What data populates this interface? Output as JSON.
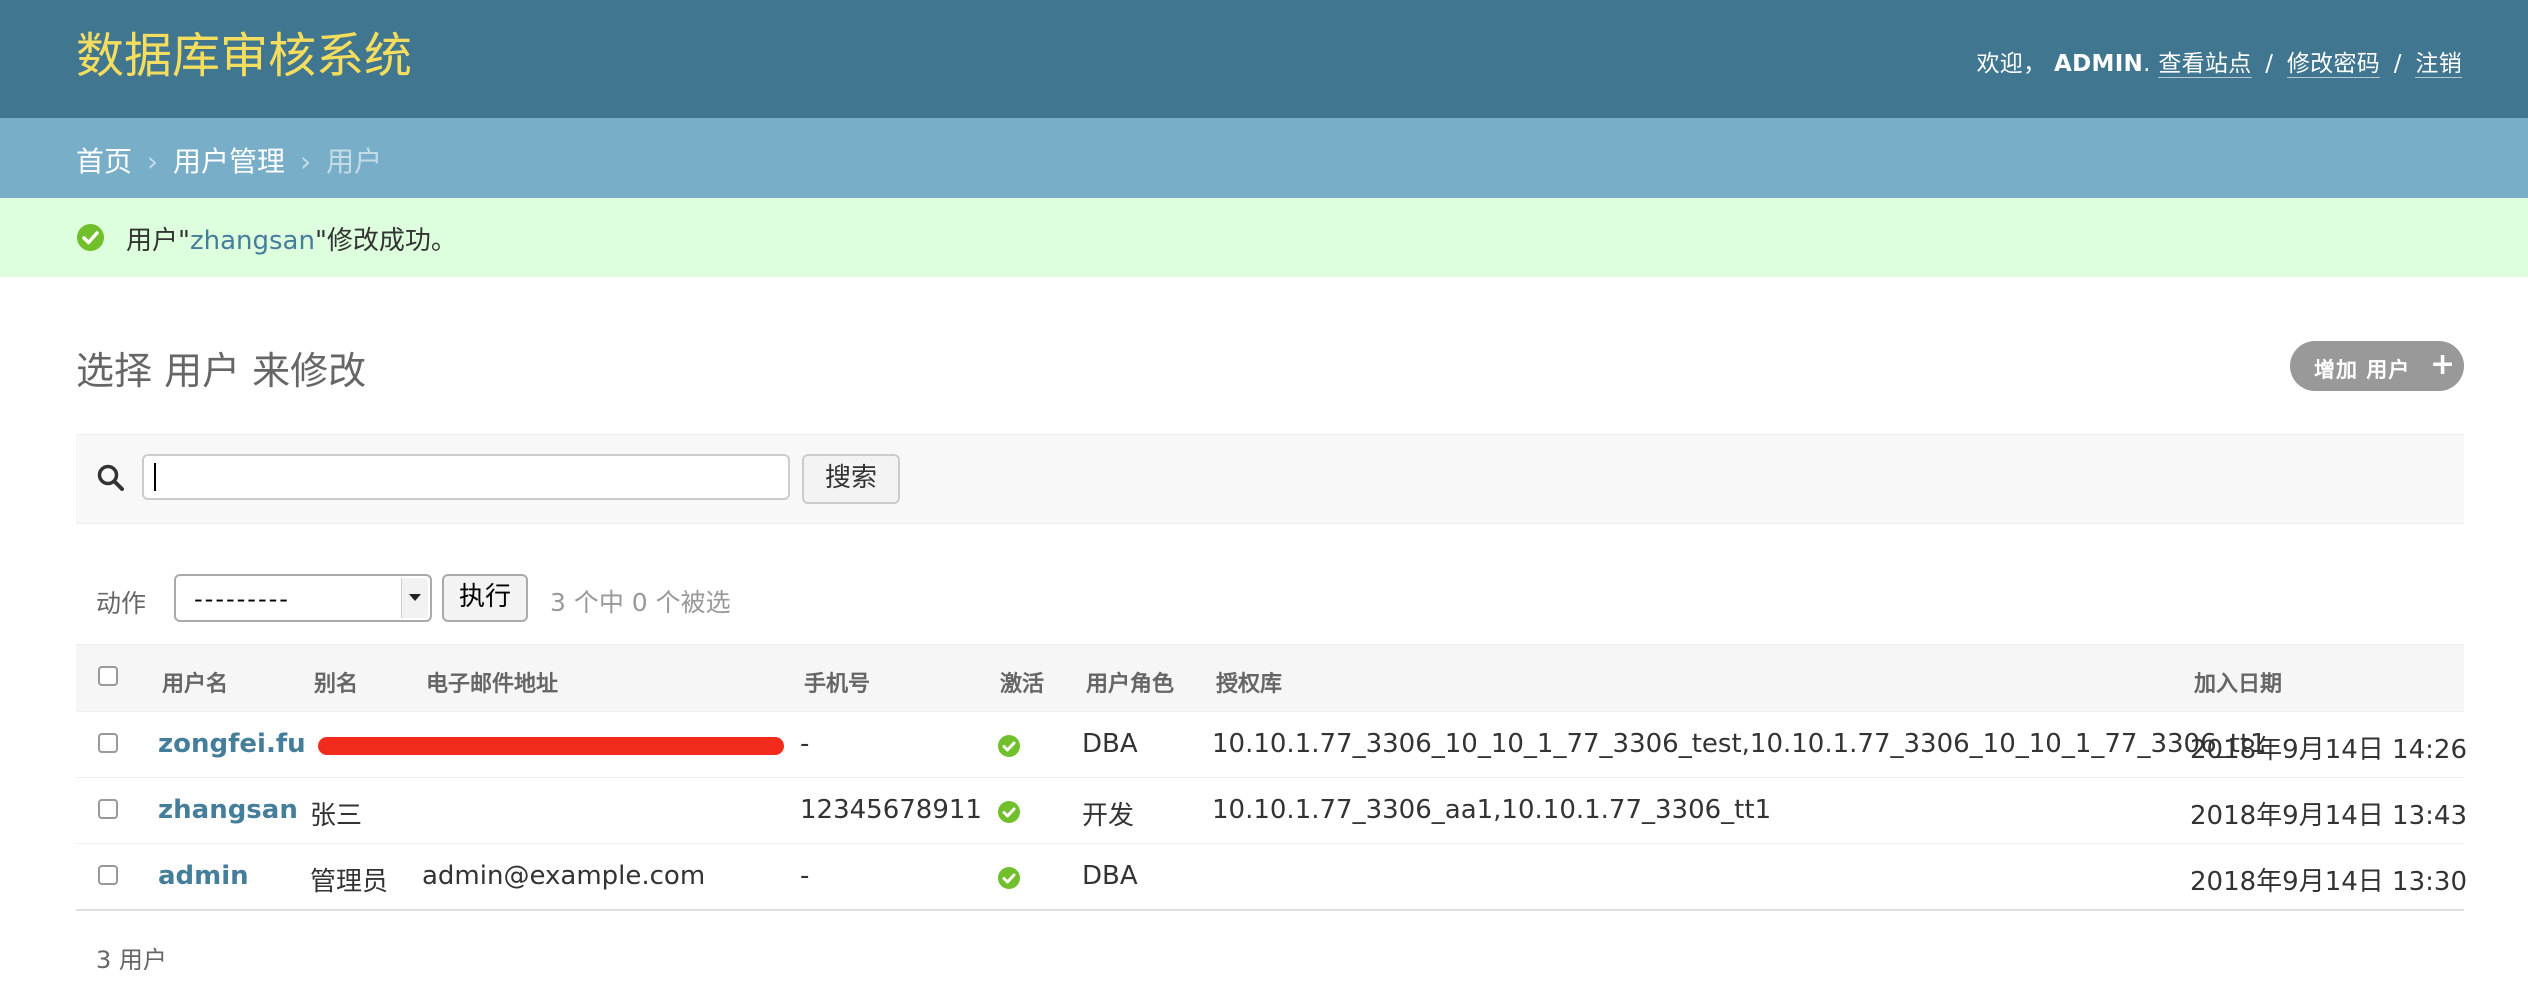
{
  "header": {
    "brand": "数据库审核系统",
    "welcome": "欢迎，",
    "username": "ADMIN",
    "dot": ".",
    "view_site": "查看站点",
    "change_password": "修改密码",
    "logout": "注销",
    "sep": "/",
    "brand_color": "#f5dd5d",
    "bg_color": "#417690"
  },
  "breadcrumbs": {
    "home": "首页",
    "app": "用户管理",
    "current": "用户",
    "sep": "›"
  },
  "message": {
    "prefix": "用户\"",
    "object": "zhangsan",
    "suffix": "\"修改成功。",
    "icon": "success-check-icon"
  },
  "page": {
    "title": "选择 用户 来修改",
    "add_button": "增加 用户",
    "add_icon": "+"
  },
  "search": {
    "value": "",
    "button": "搜索",
    "icon": "search-icon"
  },
  "actions": {
    "label": "动作",
    "selected": "---------",
    "go": "执行",
    "counter": "3 个中 0 个被选"
  },
  "table": {
    "headers": [
      "用户名",
      "别名",
      "电子邮件地址",
      "手机号",
      "激活",
      "用户角色",
      "授权库",
      "加入日期"
    ],
    "rows": [
      {
        "username": "zongfei.fu",
        "alias": "",
        "email": "",
        "phone": "-",
        "active": true,
        "role": "DBA",
        "databases": "10.10.1.77_3306_10_10_1_77_3306_test,10.10.1.77_3306_10_10_1_77_3306_tt1",
        "joined": "2018年9月14日 14:26"
      },
      {
        "username": "zhangsan",
        "alias": "张三",
        "email": "",
        "phone": "12345678911",
        "active": true,
        "role": "开发",
        "databases": "10.10.1.77_3306_aa1,10.10.1.77_3306_tt1",
        "joined": "2018年9月14日 13:43"
      },
      {
        "username": "admin",
        "alias": "管理员",
        "email": "admin@example.com",
        "phone": "-",
        "active": true,
        "role": "DBA",
        "databases": "",
        "joined": "2018年9月14日 13:30"
      }
    ]
  },
  "paginator": {
    "count": "3 用户"
  }
}
